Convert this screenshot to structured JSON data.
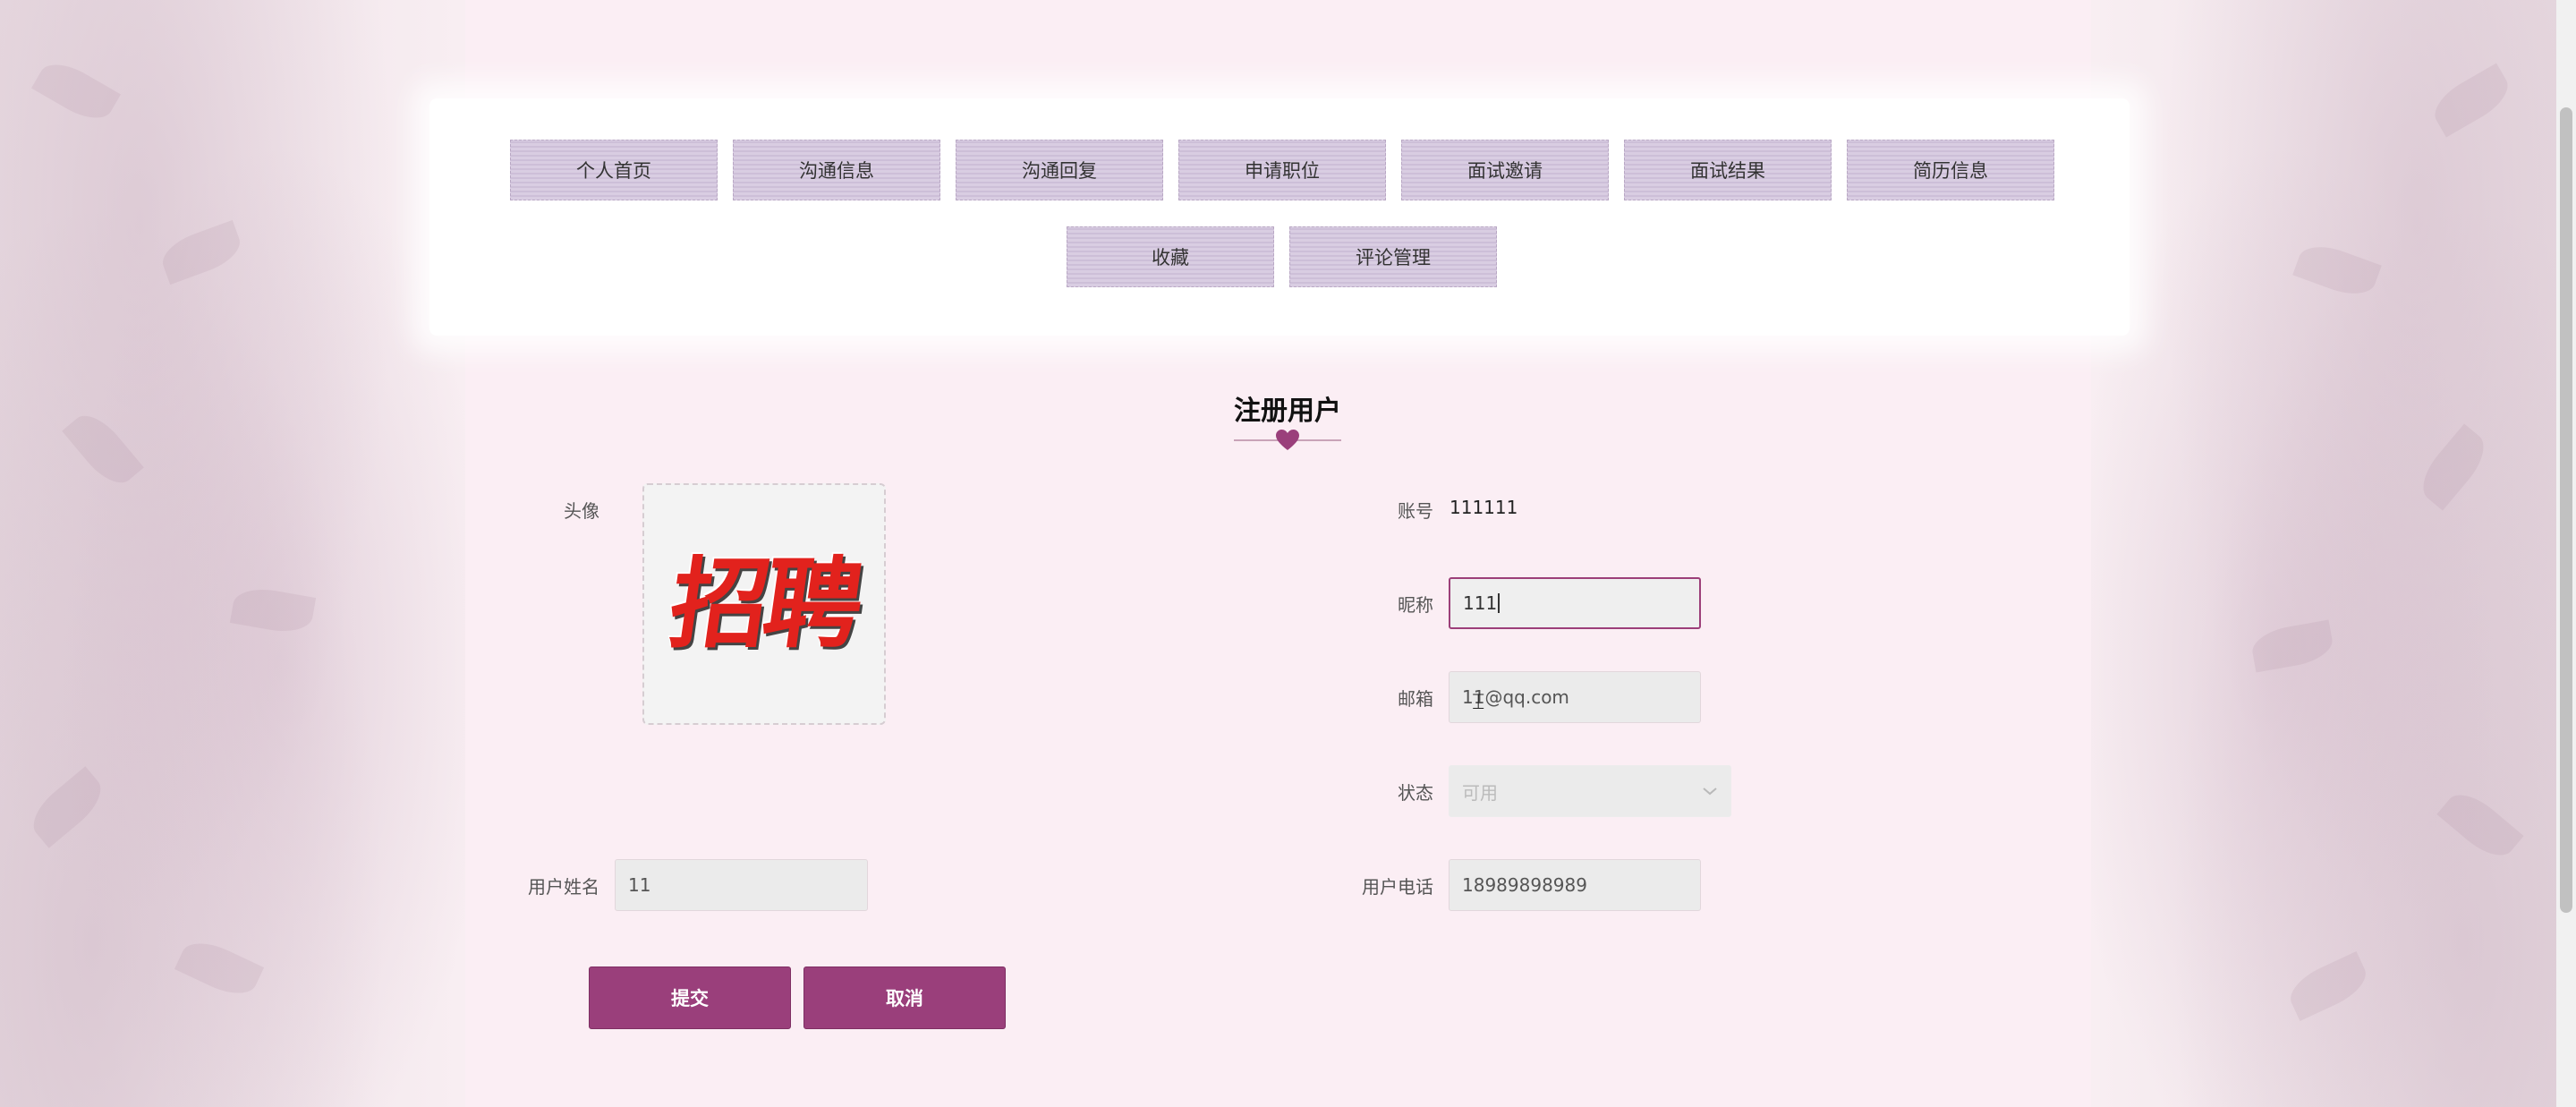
{
  "nav": {
    "items": [
      {
        "label": "个人首页"
      },
      {
        "label": "沟通信息"
      },
      {
        "label": "沟通回复"
      },
      {
        "label": "申请职位"
      },
      {
        "label": "面试邀请"
      },
      {
        "label": "面试结果"
      },
      {
        "label": "简历信息"
      },
      {
        "label": "收藏"
      },
      {
        "label": "评论管理"
      }
    ]
  },
  "form": {
    "title": "注册用户",
    "avatar_label": "头像",
    "avatar_image_text": "招聘",
    "account_label": "账号",
    "account_value": "111111",
    "nickname_label": "昵称",
    "nickname_value": "111",
    "email_label": "邮箱",
    "email_value": "11@qq.com",
    "status_label": "状态",
    "status_value": "可用",
    "username_label": "用户姓名",
    "username_value": "11",
    "phone_label": "用户电话",
    "phone_value": "18989898989"
  },
  "actions": {
    "submit_label": "提交",
    "cancel_label": "取消"
  },
  "colors": {
    "accent": "#9a3f7b",
    "nav_button": "#d9cde2",
    "background": "#fbeef4"
  }
}
